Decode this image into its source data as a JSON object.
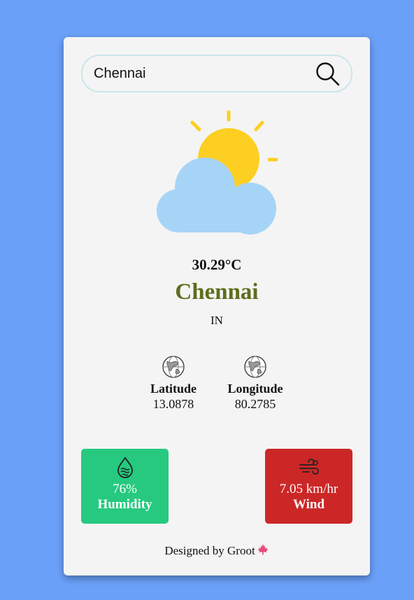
{
  "search": {
    "value": "Chennai",
    "icon": "search-icon"
  },
  "weather": {
    "icon": "partly-cloudy-icon",
    "temperature": "30.29°C",
    "city": "Chennai",
    "country": "IN"
  },
  "coordinates": {
    "latitude_label": "Latitude",
    "latitude_value": "13.0878",
    "longitude_label": "Longitude",
    "longitude_value": "80.2785",
    "icon": "globe-icon"
  },
  "humidity": {
    "value": "76%",
    "label": "Humidity",
    "icon": "humidity-drop-icon",
    "color": "#26c97f"
  },
  "wind": {
    "value": "7.05 km/hr",
    "label": "Wind",
    "icon": "wind-icon",
    "color": "#cc2727"
  },
  "footer": {
    "text": "Designed by Groot",
    "icon": "maple-leaf-icon"
  },
  "colors": {
    "background": "#6aa0f8",
    "card": "#f4f4f4",
    "city_text": "#5c6e1c",
    "sun": "#fccf22",
    "cloud": "#a6d4f7"
  }
}
